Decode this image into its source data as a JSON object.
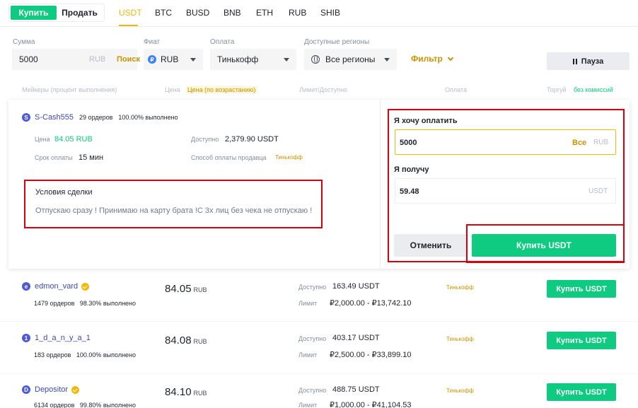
{
  "topbar": {
    "buy_label": "Купить",
    "sell_label": "Продать",
    "assets": [
      "USDT",
      "BTC",
      "BUSD",
      "BNB",
      "ETH",
      "RUB",
      "SHIB"
    ],
    "active_asset": "USDT"
  },
  "filters": {
    "amount_label": "Сумма",
    "amount_value": "5000",
    "amount_currency": "RUB",
    "search_label": "Поиск",
    "fiat_label": "Фиат",
    "fiat_value": "RUB",
    "payment_label": "Оплата",
    "payment_value": "Тинькофф",
    "regions_label": "Доступные регионы",
    "regions_value": "Все регионы",
    "filter_label": "Фильтр",
    "pause_label": "Пауза"
  },
  "columns": {
    "makers": "Мейкеры (процент выполнения)",
    "price": "Цена",
    "price_sort": "Цена (по возрастанию)",
    "limit": "Лимит/Доступно",
    "payment": "Оплата",
    "trade": "Торгуй",
    "no_fee": "без комиссий"
  },
  "expanded": {
    "avatar_letter": "S",
    "name": "S-Cash555",
    "orders": "29 ордеров",
    "completion": "100.00% выполнено",
    "price_label": "Цена",
    "price_value": "84.05 RUB",
    "available_label": "Доступно",
    "available_value": "2,379.90 USDT",
    "time_label": "Срок оплаты",
    "time_value": "15 мин",
    "method_label": "Способ оплаты продавца",
    "method_value": "Тинькофф",
    "terms_title": "Условия сделки",
    "terms_text": "Отпускаю сразу ! Принимаю на карту брата !С 3х лиц без чека не отпускаю !",
    "pay_label": "Я хочу оплатить",
    "pay_value": "5000",
    "pay_all": "Все",
    "pay_currency": "RUB",
    "receive_label": "Я получу",
    "receive_value": "59.48",
    "receive_currency": "USDT",
    "cancel_label": "Отменить",
    "buy_label": "Купить USDT"
  },
  "rows": [
    {
      "avatar_letter": "e",
      "name": "edmon_vard",
      "verified": true,
      "orders_line": "1479 ордеров   98.30% выполнено",
      "price": "84.05",
      "unit": "RUB",
      "available_label": "Доступно",
      "available": "163.49 USDT",
      "limit_label": "Лимит",
      "limit": "₽2,000.00 - ₽13,742.10",
      "payment": "Тинькофф",
      "button": "Купить USDT"
    },
    {
      "avatar_letter": "1",
      "name": "1_d_a_n_y_a_1",
      "verified": false,
      "orders_line": "183 ордеров   100.00% выполнено",
      "price": "84.08",
      "unit": "RUB",
      "available_label": "Доступно",
      "available": "403.17 USDT",
      "limit_label": "Лимит",
      "limit": "₽2,500.00 - ₽33,899.10",
      "payment": "Тинькофф",
      "button": "Купить USDT"
    },
    {
      "avatar_letter": "D",
      "name": "Depositor",
      "verified": true,
      "orders_line": "6134 ордеров   99.80% выполнено",
      "price": "84.10",
      "unit": "RUB",
      "available_label": "Доступно",
      "available": "488.75 USDT",
      "limit_label": "Лимит",
      "limit": "₽1,000.00 - ₽41,104.53",
      "payment": "Тинькофф",
      "button": "Купить USDT"
    }
  ],
  "colors": {
    "green": "#0ecb81",
    "yellow": "#f0b90b",
    "annotation_red": "#d9000d"
  }
}
